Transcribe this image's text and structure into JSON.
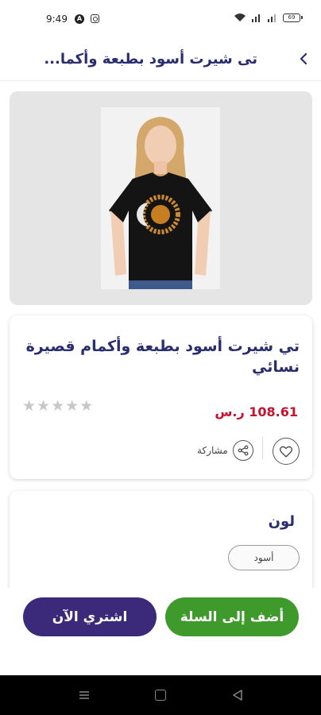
{
  "status_bar": {
    "time": "9:49",
    "battery": "69"
  },
  "header": {
    "title": "تى شيرت أسود بطبعة وأكما..."
  },
  "product": {
    "name": "تي شيرت أسود بطبعة وأكمام قصيرة نسائي",
    "price": "108.61 ر.س",
    "rating": 0,
    "rating_max": 5,
    "share_label": "مشاركة"
  },
  "options": {
    "color_title": "لون",
    "selected_color": "أسود"
  },
  "actions": {
    "add_to_cart": "أضف إلى السلة",
    "buy_now": "اشتري الآن"
  },
  "colors": {
    "brand": "#2a2d6e",
    "price": "#c4122f",
    "buy_now": "#3b2a7a",
    "add_to_cart": "#3f9a2c"
  }
}
